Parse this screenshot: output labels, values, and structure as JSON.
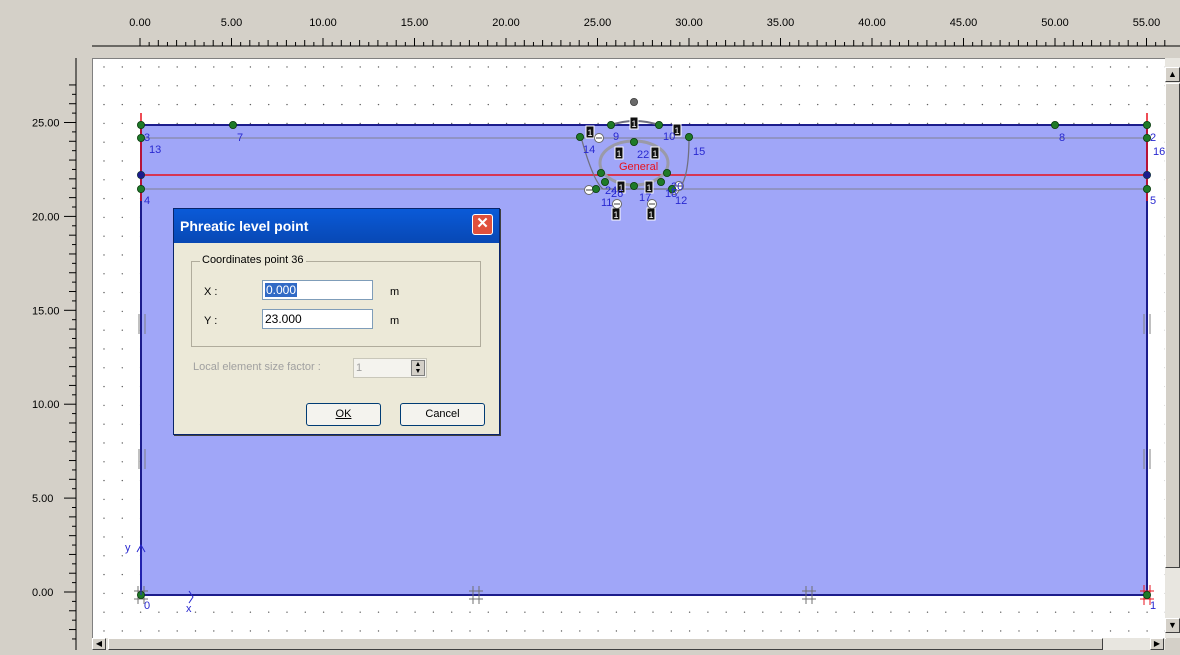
{
  "ruler": {
    "x_labels": [
      "0.00",
      "5.00",
      "10.00",
      "15.00",
      "20.00",
      "25.00",
      "30.00",
      "35.00",
      "40.00",
      "45.00",
      "50.00",
      "55.00"
    ],
    "y_labels": [
      "25.00",
      "20.00",
      "15.00",
      "10.00",
      "5.00",
      "0.00"
    ]
  },
  "model": {
    "point_labels": [
      "0",
      "1",
      "2",
      "3",
      "4",
      "5",
      "7",
      "8",
      "9",
      "10",
      "11",
      "12",
      "13",
      "14",
      "15",
      "16",
      "17",
      "18",
      "20",
      "22",
      "24",
      "26"
    ],
    "cluster_label": "General",
    "cluster_number": "1",
    "axis_y": "y",
    "axis_x": "x",
    "colors": {
      "soil": "#a0a6f8",
      "boundary": "#1c1c8c",
      "phreatic": "#e8101c",
      "point": "#1e7a28",
      "label": "#2828d0"
    }
  },
  "dialog": {
    "title": "Phreatic level point",
    "close_glyph": "✕",
    "group_title": "Coordinates point 36",
    "x_label": "X :",
    "x_value": "0.000",
    "y_label": "Y :",
    "y_value": "23.000",
    "unit": "m",
    "size_factor_label": "Local element size factor :",
    "size_factor_value": "1",
    "ok_label": "OK",
    "cancel_label": "Cancel"
  }
}
